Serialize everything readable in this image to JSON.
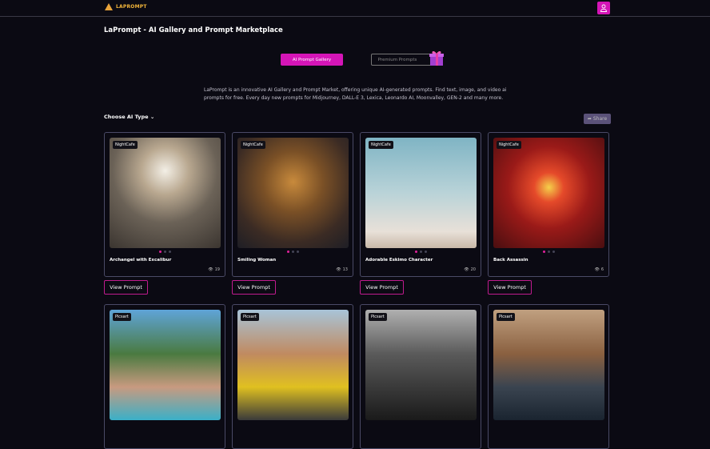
{
  "header": {
    "logo": "LAPROMPT",
    "user_icon": "user-icon"
  },
  "page_title": "LaPrompt - AI Gallery and Prompt Marketplace",
  "tabs": {
    "gallery": "AI Prompt Gallery",
    "premium": "Premium Prompts"
  },
  "description": "LaPrompt is an innovative AI Gallery and Prompt Market, offering unique AI-generated prompts. Find text, image, and video ai prompts for free. Every day new prompts for Midjourney, DALL-E 3, Lexica, Leonardo AI, Moonvalley, GEN-2 and many more.",
  "filter": {
    "label": "Choose AI Type"
  },
  "share_label": "Share",
  "view_prompt_label": "View Prompt",
  "colors": {
    "accent": "#d515b7",
    "bg": "#0b0a13"
  },
  "cards": [
    {
      "badge": "NightCafe",
      "title": "Archangel with Excalibur",
      "views": "19"
    },
    {
      "badge": "NightCafe",
      "title": "Smiling Woman",
      "views": "13"
    },
    {
      "badge": "NightCafe",
      "title": "Adorable Eskimo Character",
      "views": "20"
    },
    {
      "badge": "NightCafe",
      "title": "Back Assassin",
      "views": "6"
    },
    {
      "badge": "Picsart"
    },
    {
      "badge": "Picsart"
    },
    {
      "badge": "Picsart"
    },
    {
      "badge": "Picsart"
    }
  ]
}
